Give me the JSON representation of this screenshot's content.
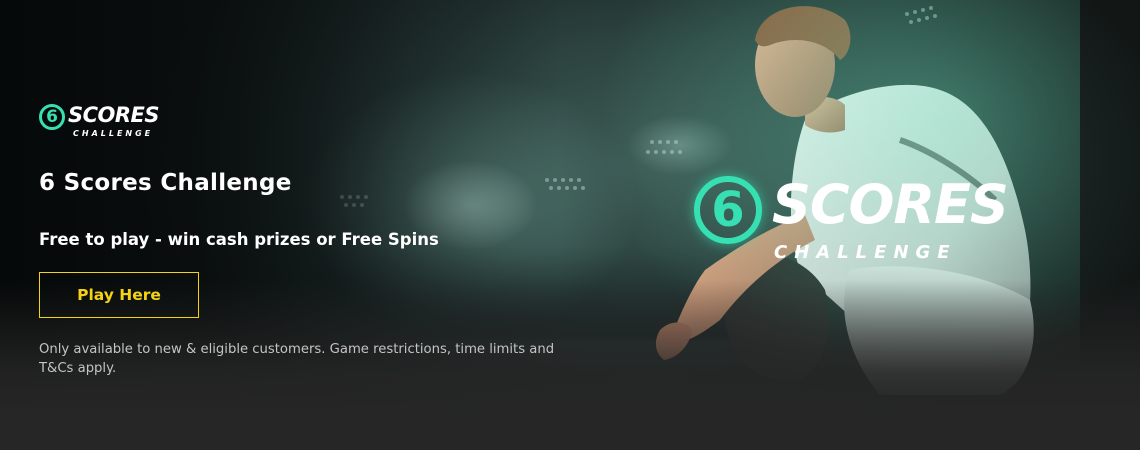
{
  "banner": {
    "small_logo": {
      "number": "6",
      "word": "SCORES",
      "sub": "CHALLENGE"
    },
    "big_logo": {
      "number": "6",
      "word": "SCORES",
      "sub": "CHALLENGE"
    },
    "title": "6 Scores Challenge",
    "tagline": "Free to play - win cash prizes or Free Spins",
    "cta_label": "Play Here",
    "terms": "Only available to new & eligible customers. Game restrictions, time limits and T&Cs apply."
  },
  "colors": {
    "accent_teal": "#37e0b2",
    "cta_yellow": "#f5d312",
    "background": "#262626"
  },
  "icons": {
    "logo_mark": "circle-six-logo-icon"
  }
}
